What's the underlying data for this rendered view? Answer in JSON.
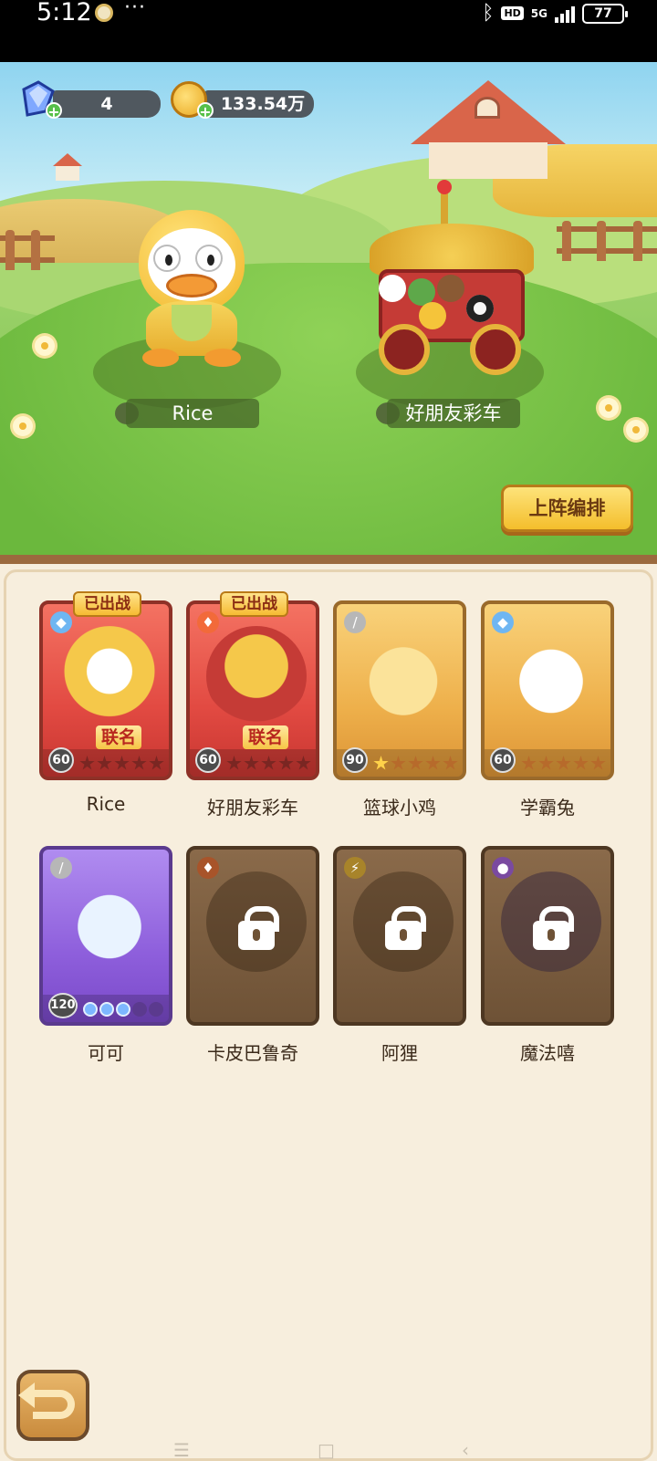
{
  "status_bar": {
    "time": "5:12",
    "dots": "···",
    "hd_label": "HD",
    "network_label": "5G",
    "battery": "77"
  },
  "resources": {
    "gems": "4",
    "coins": "133.54万"
  },
  "scene": {
    "left_character_name": "Rice",
    "right_character_name": "好朋友彩车",
    "lineup_button_label": "上阵编排"
  },
  "cards": [
    {
      "name": "Rice",
      "level": "60",
      "stars_on": 0,
      "theme": "red",
      "element": "water",
      "collab_label": "联名",
      "deployed_label": "已出战",
      "locked": false
    },
    {
      "name": "好朋友彩车",
      "level": "60",
      "stars_on": 0,
      "theme": "red",
      "element": "fire",
      "collab_label": "联名",
      "deployed_label": "已出战",
      "locked": false
    },
    {
      "name": "篮球小鸡",
      "level": "90",
      "stars_on": 1,
      "theme": "gold",
      "element": "sword",
      "locked": false
    },
    {
      "name": "学霸兔",
      "level": "60",
      "stars_on": 0,
      "theme": "gold",
      "element": "water",
      "locked": false
    },
    {
      "name": "可可",
      "level": "120",
      "stars_on": 3,
      "theme": "purple",
      "element": "sword",
      "locked": false
    },
    {
      "name": "卡皮巴鲁奇",
      "theme": "locked",
      "element": "fire",
      "locked": true
    },
    {
      "name": "阿狸",
      "theme": "locked",
      "element": "lightning",
      "locked": true
    },
    {
      "name": "魔法嘻",
      "theme": "locked",
      "element": "potion",
      "locked": true
    }
  ],
  "colors": {
    "panel_bg": "#f7eedd",
    "button_gold": "#f4be2c",
    "card_red": "#e24a42",
    "card_gold": "#eeb04b",
    "card_purple": "#8e5fdc"
  }
}
